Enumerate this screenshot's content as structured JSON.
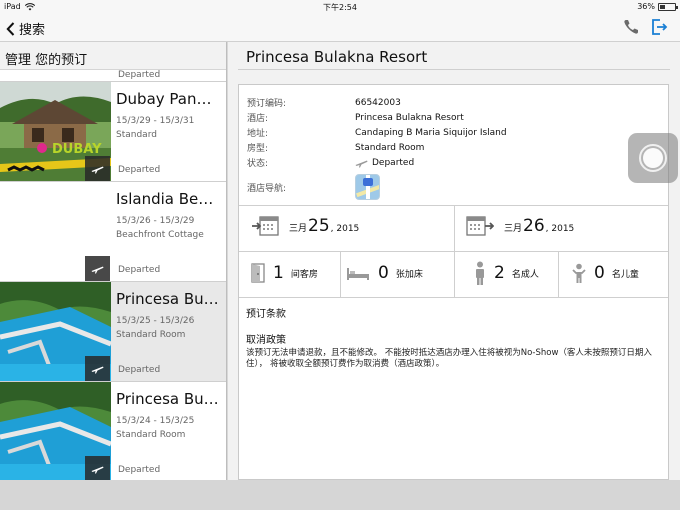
{
  "statusbar": {
    "device": "iPad",
    "time": "下午2:54",
    "battery": "36%",
    "battery_level": 0.36
  },
  "navbar": {
    "back_label": "搜索"
  },
  "sidebar": {
    "header": "管理 您的预订",
    "first_status": "Departed",
    "items": [
      {
        "title": "Dubay Pang…",
        "dates": "15/3/29 - 15/3/31",
        "room": "Standard",
        "status": "Departed",
        "thumb_text": "DUBAY"
      },
      {
        "title": "Islandia Bea…",
        "dates": "15/3/26 - 15/3/29",
        "room": "Beachfront Cottage",
        "status": "Departed"
      },
      {
        "title": "Princesa Bul…",
        "dates": "15/3/25 - 15/3/26",
        "room": "Standard Room",
        "status": "Departed"
      },
      {
        "title": "Princesa Bul…",
        "dates": "15/3/24 - 15/3/25",
        "room": "Standard Room",
        "status": "Departed"
      }
    ]
  },
  "main": {
    "title": "Princesa Bulakna Resort",
    "details": {
      "booking_no_label": "预订编码:",
      "booking_no": "66542003",
      "hotel_label": "酒店:",
      "hotel": "Princesa Bulakna Resort",
      "address_label": "地址:",
      "address": "Candaping B  Maria Siquijor Island",
      "room_label": "房型:",
      "room": "Standard Room",
      "status_label": "状态:",
      "status": "Departed",
      "nav_label": "酒店导航:"
    },
    "checkin": {
      "month": "三月",
      "day": "25",
      "year": ", 2015"
    },
    "checkout": {
      "month": "三月",
      "day": "26",
      "year": ", 2015"
    },
    "counts": {
      "rooms": {
        "num": "1",
        "unit": "间客房"
      },
      "extra_beds": {
        "num": "0",
        "unit": "张加床"
      },
      "adults": {
        "num": "2",
        "unit": "名成人"
      },
      "children": {
        "num": "0",
        "unit": "名儿童"
      }
    },
    "terms": {
      "heading": "预订条款",
      "cancel_heading": "取消政策",
      "cancel_body": "该预订无法申请退款，且不能修改。 不能按时抵达酒店办理入住将被视为No-Show（客人未按照预订日期入住）， 将被收取全额预订费作为取消费（酒店政策）。"
    }
  },
  "colors": {
    "accent": "#1a7fd4",
    "plane": "#ffffff"
  }
}
